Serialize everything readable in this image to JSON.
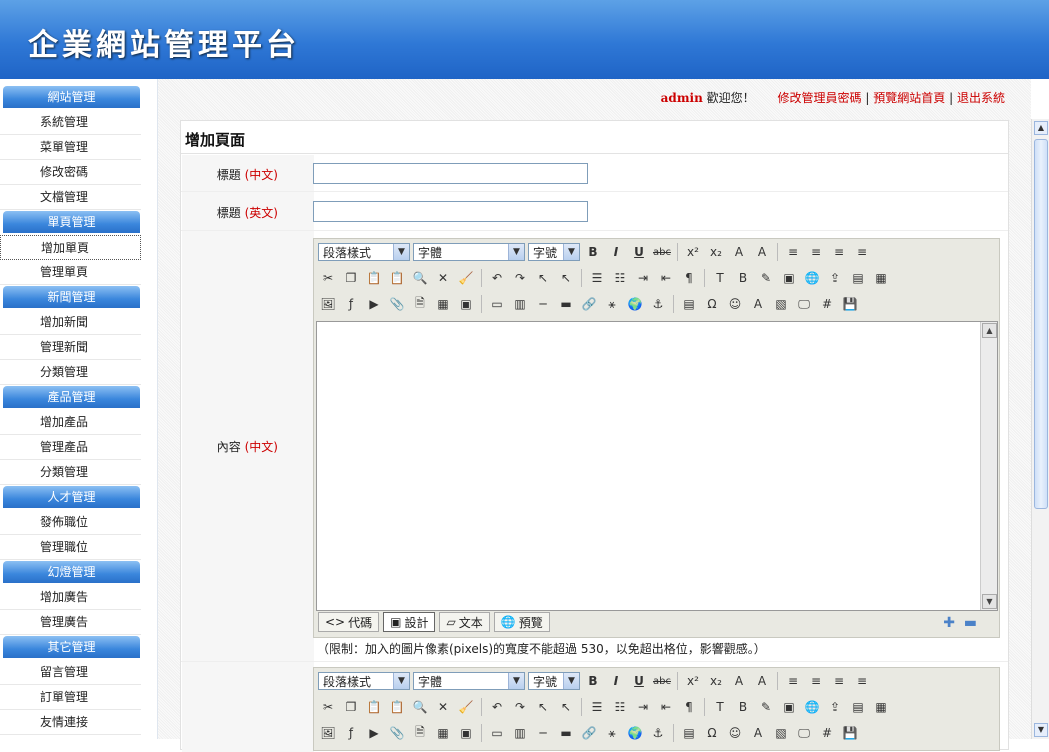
{
  "header": {
    "logo": "企業網站管理平台"
  },
  "sidebar": {
    "groups": [
      {
        "title": "網站管理",
        "items": [
          "系統管理",
          "菜單管理",
          "修改密碼",
          "文檔管理"
        ]
      },
      {
        "title": "單頁管理",
        "items": [
          "增加單頁",
          "管理單頁"
        ]
      },
      {
        "title": "新聞管理",
        "items": [
          "增加新聞",
          "管理新聞",
          "分類管理"
        ]
      },
      {
        "title": "產品管理",
        "items": [
          "增加產品",
          "管理產品",
          "分類管理"
        ]
      },
      {
        "title": "人才管理",
        "items": [
          "發佈職位",
          "管理職位"
        ]
      },
      {
        "title": "幻燈管理",
        "items": [
          "增加廣告",
          "管理廣告"
        ]
      },
      {
        "title": "其它管理",
        "items": [
          "留言管理",
          "訂單管理",
          "友情連接"
        ]
      }
    ],
    "active_item": "增加單頁"
  },
  "topnav": {
    "user": "admin",
    "welcome": "歡迎您！",
    "change_password": "修改管理員密碼",
    "preview_home": "預覽網站首頁",
    "logout": "退出系統",
    "sep": "|"
  },
  "form": {
    "title": "增加頁面",
    "title_cn_label": "標題",
    "title_cn_tag": "(中文)",
    "title_en_label": "標題",
    "title_en_tag": "(英文)",
    "content_label": "內容",
    "content_tag": "(中文)",
    "title_cn_value": "",
    "title_en_value": ""
  },
  "editor": {
    "paragraph_style": "段落樣式",
    "font": "字體",
    "font_size": "字號",
    "tabs": {
      "code": "代碼",
      "design": "設計",
      "text": "文本",
      "preview": "預覽"
    },
    "note": "（限制：加入的圖片像素(pixels)的寬度不能超過 530，以免超出格位，影響觀感。）"
  }
}
